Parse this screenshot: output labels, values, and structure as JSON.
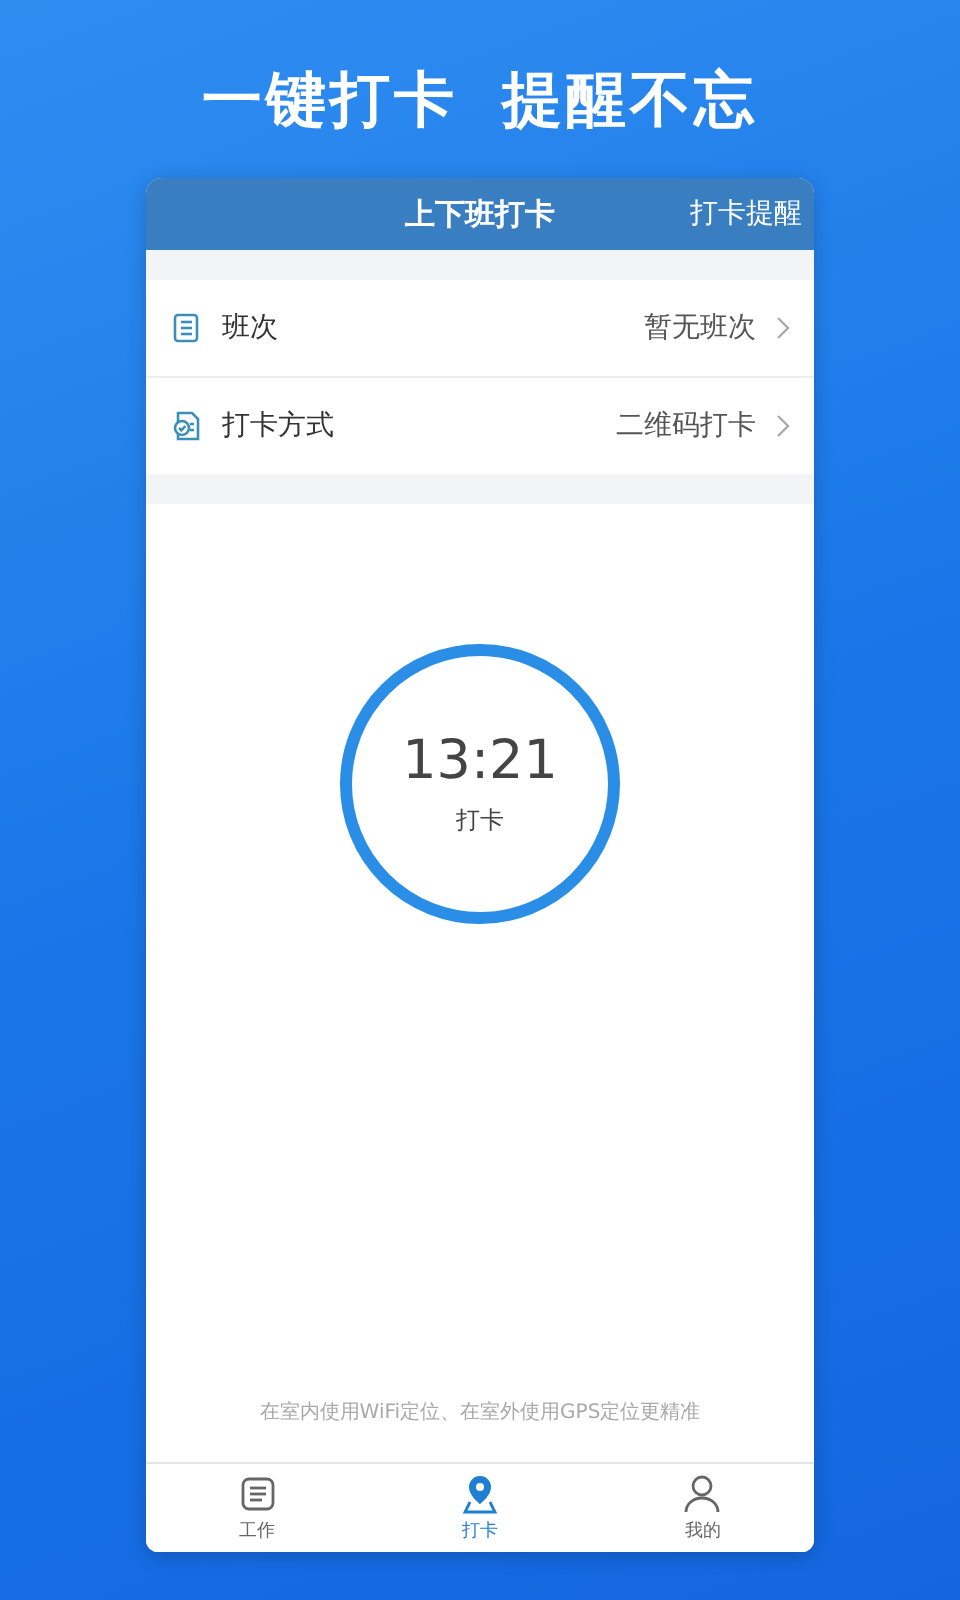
{
  "headline": [
    "一键打卡",
    "提醒不忘"
  ],
  "header": {
    "title": "上下班打卡",
    "action": "打卡提醒"
  },
  "settings": [
    {
      "kind": "list",
      "label": "班次",
      "value": "暂无班次"
    },
    {
      "kind": "qr",
      "label": "打卡方式",
      "value": "二维码打卡"
    }
  ],
  "clock": {
    "time": "13:21",
    "label": "打卡"
  },
  "hint": "在室内使用WiFi定位、在室外使用GPS定位更精准",
  "tabs": [
    {
      "kind": "list",
      "label": "工作",
      "selected": false
    },
    {
      "kind": "pin",
      "label": "打卡",
      "selected": true
    },
    {
      "kind": "person",
      "label": "我的",
      "selected": false
    }
  ]
}
